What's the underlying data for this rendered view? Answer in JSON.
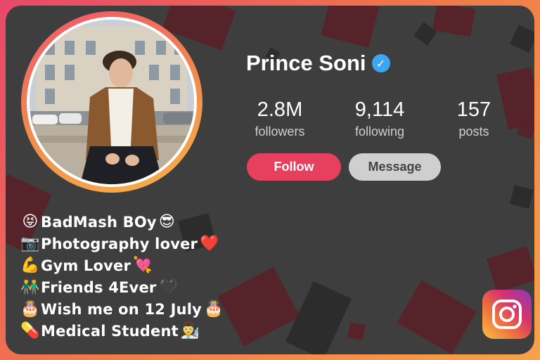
{
  "profile": {
    "name": "Prince Soni",
    "stats": [
      {
        "value": "2.8M",
        "label": "followers"
      },
      {
        "value": "9,114",
        "label": "following"
      },
      {
        "value": "157",
        "label": "posts"
      }
    ],
    "buttons": {
      "follow": "Follow",
      "message": "Message"
    }
  },
  "bio": [
    {
      "prefix": "😝",
      "text": "BadMash BOy",
      "suffix": "😎"
    },
    {
      "prefix": "📷",
      "text": "Photography lover",
      "suffix": "❤️"
    },
    {
      "prefix": "💪",
      "text": "Gym Lover",
      "suffix": "💘"
    },
    {
      "prefix": "👬",
      "text": "Friends 4Ever",
      "suffix": "🖤"
    },
    {
      "prefix": "🎂",
      "text": "Wish me on 12 July",
      "suffix": "🎂"
    },
    {
      "prefix": "💊",
      "text": "Medical Student ",
      "suffix": "👨‍🔬"
    }
  ],
  "icons": {
    "verified": "verified-badge-icon",
    "brand": "instagram-logo-icon"
  },
  "colors": {
    "accent": "#e6405e",
    "verified": "#3aa7f0",
    "background": "#3e3e3e",
    "message_button": "#cfcfcf"
  }
}
